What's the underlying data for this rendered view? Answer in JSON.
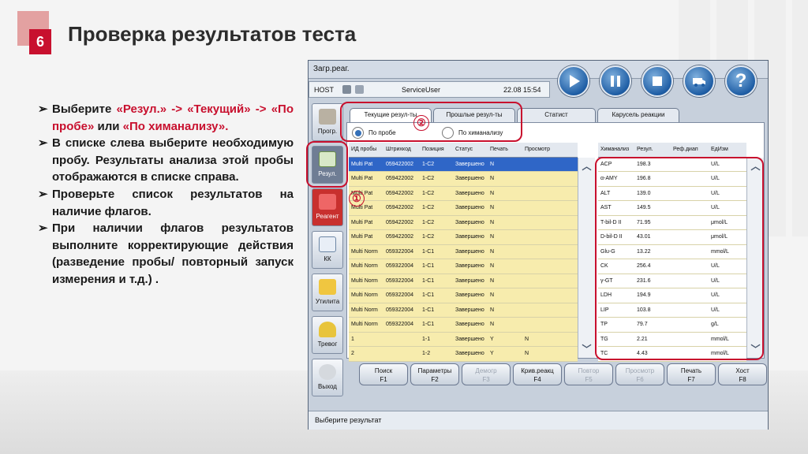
{
  "slide": {
    "number": "6",
    "title": "Проверка результатов теста",
    "instructions": [
      {
        "bullet": "➢",
        "parts": [
          {
            "t": "Выберите ",
            "red": false
          },
          {
            "t": "«Резул.» -> «Текущий» -> «По пробе»",
            "red": true
          },
          {
            "t": " или ",
            "red": false
          },
          {
            "t": "«По химанализу».",
            "red": true
          }
        ]
      },
      {
        "bullet": "➢",
        "parts": [
          {
            "t": "В списке слева выберите необходимую пробу. Результаты анализа этой пробы отображаются в списке справа.",
            "red": false
          }
        ]
      },
      {
        "bullet": "➢",
        "parts": [
          {
            "t": "Проверьте список результатов на наличие флагов.",
            "red": false
          }
        ]
      },
      {
        "bullet": "➢",
        "parts": [
          {
            "t": "При наличии флагов результатов выполните корректирующие действия (разведение пробы/ повторный запуск измерения и т.д.) .",
            "red": false
          }
        ]
      }
    ]
  },
  "app": {
    "top_label": "Загр.реаг.",
    "host": "HOST",
    "user": "ServiceUser",
    "time": "22.08 15:54",
    "sidebar": [
      "Прогр.",
      "Резул.",
      "Реагент",
      "КК",
      "Утилита",
      "Тревог",
      "Выход"
    ],
    "tabs": [
      "Текущие резул-ты",
      "Прошлые резул-ты",
      "Статист",
      "Карусель реакции"
    ],
    "radio": {
      "by_sample": "По пробе",
      "by_chem": "По химанализу"
    },
    "left_headers": [
      "ИД пробы",
      "Штрихкод",
      "Позиция",
      "Статус",
      "Печать",
      "Просмотр"
    ],
    "left_rows": [
      [
        "Multi Pat",
        "059422002",
        "1-C2",
        "Завершено",
        "N",
        ""
      ],
      [
        "Multi Pat",
        "059422002",
        "1-C2",
        "Завершено",
        "N",
        ""
      ],
      [
        "Multi Pat",
        "059422002",
        "1-C2",
        "Завершено",
        "N",
        ""
      ],
      [
        "Multi Pat",
        "059422002",
        "1-C2",
        "Завершено",
        "N",
        ""
      ],
      [
        "Multi Pat",
        "059422002",
        "1-C2",
        "Завершено",
        "N",
        ""
      ],
      [
        "Multi Pat",
        "059422002",
        "1-C2",
        "Завершено",
        "N",
        ""
      ],
      [
        "Multi Norm",
        "059322004",
        "1-C1",
        "Завершено",
        "N",
        ""
      ],
      [
        "Multi Norm",
        "059322004",
        "1-C1",
        "Завершено",
        "N",
        ""
      ],
      [
        "Multi Norm",
        "059322004",
        "1-C1",
        "Завершено",
        "N",
        ""
      ],
      [
        "Multi Norm",
        "059322004",
        "1-C1",
        "Завершено",
        "N",
        ""
      ],
      [
        "Multi Norm",
        "059322004",
        "1-C1",
        "Завершено",
        "N",
        ""
      ],
      [
        "Multi Norm",
        "059322004",
        "1-C1",
        "Завершено",
        "N",
        ""
      ],
      [
        "1",
        "",
        "1-1",
        "Завершено",
        "Y",
        "N"
      ],
      [
        "2",
        "",
        "1-2",
        "Завершено",
        "Y",
        "N"
      ]
    ],
    "right_headers": [
      "Химанализ",
      "Резул.",
      "Реф.диап",
      "ЕдИзм"
    ],
    "right_rows": [
      [
        "ACP",
        "198.3",
        "",
        "U/L"
      ],
      [
        "α-AMY",
        "196.8",
        "",
        "U/L"
      ],
      [
        "ALT",
        "139.0",
        "",
        "U/L"
      ],
      [
        "AST",
        "149.5",
        "",
        "U/L"
      ],
      [
        "T-bil-D II",
        "71.95",
        "",
        "μmol/L"
      ],
      [
        "D-bil-D II",
        "43.01",
        "",
        "μmol/L"
      ],
      [
        "Glu-G",
        "13.22",
        "",
        "mmol/L"
      ],
      [
        "CK",
        "256.4",
        "",
        "U/L"
      ],
      [
        "γ-GT",
        "231.6",
        "",
        "U/L"
      ],
      [
        "LDH",
        "194.9",
        "",
        "U/L"
      ],
      [
        "LIP",
        "103.8",
        "",
        "U/L"
      ],
      [
        "TP",
        "79.7",
        "",
        "g/L"
      ],
      [
        "TG",
        "2.21",
        "",
        "mmol/L"
      ],
      [
        "TC",
        "4.43",
        "",
        "mmol/L"
      ]
    ],
    "fkeys": [
      {
        "l1": "Поиск",
        "l2": "F1",
        "disabled": false
      },
      {
        "l1": "Параметры",
        "l2": "F2",
        "disabled": false
      },
      {
        "l1": "Демогр",
        "l2": "F3",
        "disabled": true
      },
      {
        "l1": "Крив.реакц",
        "l2": "F4",
        "disabled": false
      },
      {
        "l1": "Повтор",
        "l2": "F5",
        "disabled": true
      },
      {
        "l1": "Просмотр",
        "l2": "F6",
        "disabled": true
      },
      {
        "l1": "Печать",
        "l2": "F7",
        "disabled": false
      },
      {
        "l1": "Хост",
        "l2": "F8",
        "disabled": false
      }
    ],
    "status": "Выберите результат"
  },
  "annotations": {
    "one": "①",
    "two": "②"
  },
  "colors": {
    "accent": "#c8102e",
    "selected_row": "#2f66c7",
    "sample_row": "#f7ecad"
  }
}
